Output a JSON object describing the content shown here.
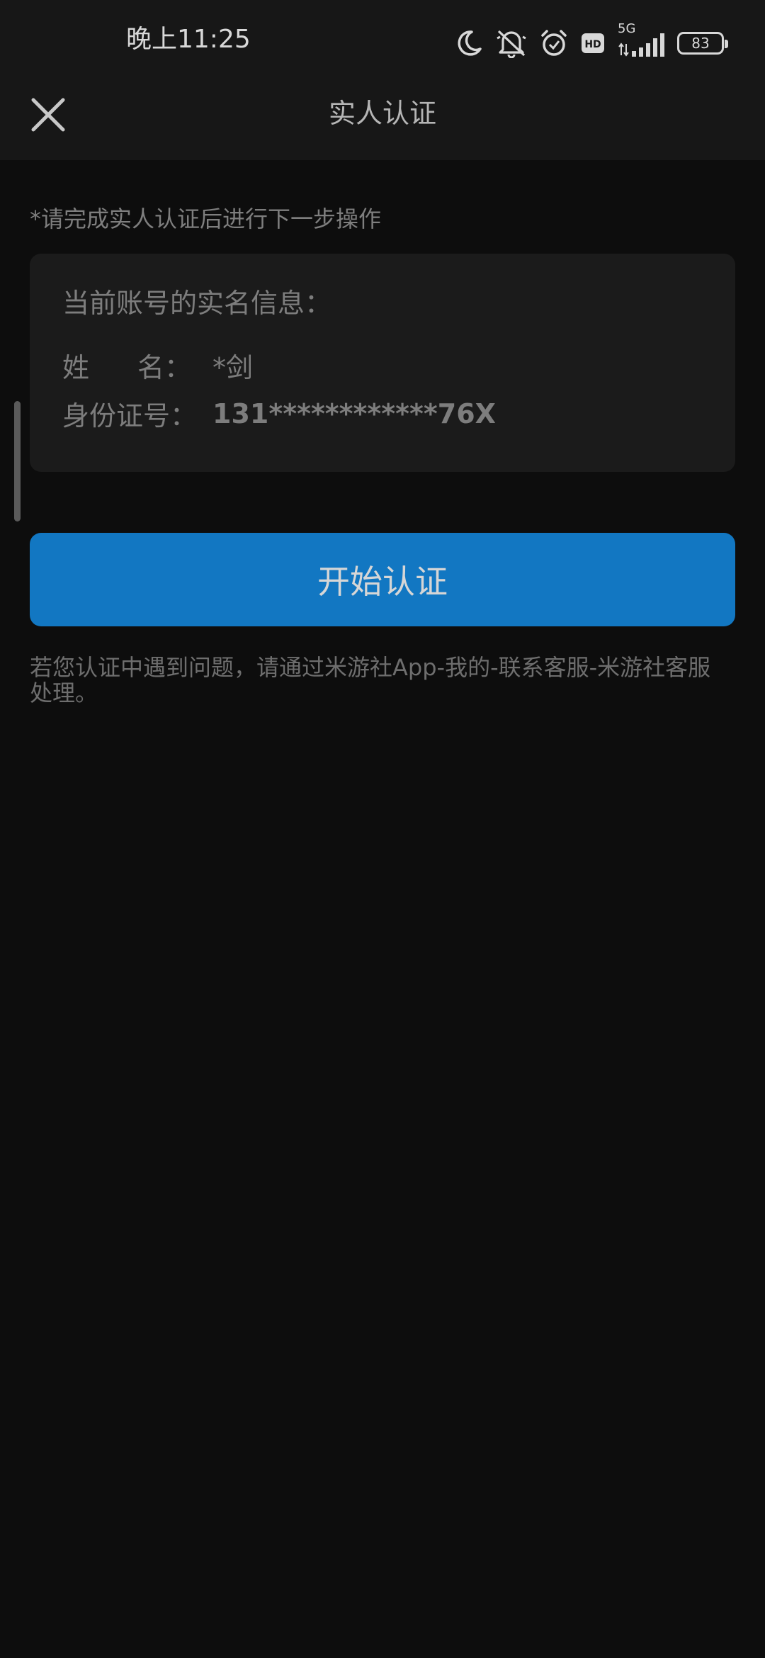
{
  "status_bar": {
    "time": "晚上11:25",
    "network": "5G",
    "battery": "83",
    "icons": [
      "moon-icon",
      "bell-off-icon",
      "alarm-icon",
      "hd-icon",
      "signal-icon",
      "battery-icon"
    ]
  },
  "header": {
    "title": "实人认证",
    "close_icon": "close-icon"
  },
  "notice": "*请完成实人认证后进行下一步操作",
  "card": {
    "title": "当前账号的实名信息：",
    "name_label_1": "姓",
    "name_label_2": "名：",
    "name_value": "*剑",
    "id_label": "身份证号：",
    "id_value": "131************76X"
  },
  "start_button": "开始认证",
  "help_text": "若您认证中遇到问题，请通过米游社App-我的-联系客服-米游社客服 处理。",
  "colors": {
    "background": "#0d0d0d",
    "header": "#171717",
    "card": "#1b1b1b",
    "button": "#1277c2"
  }
}
